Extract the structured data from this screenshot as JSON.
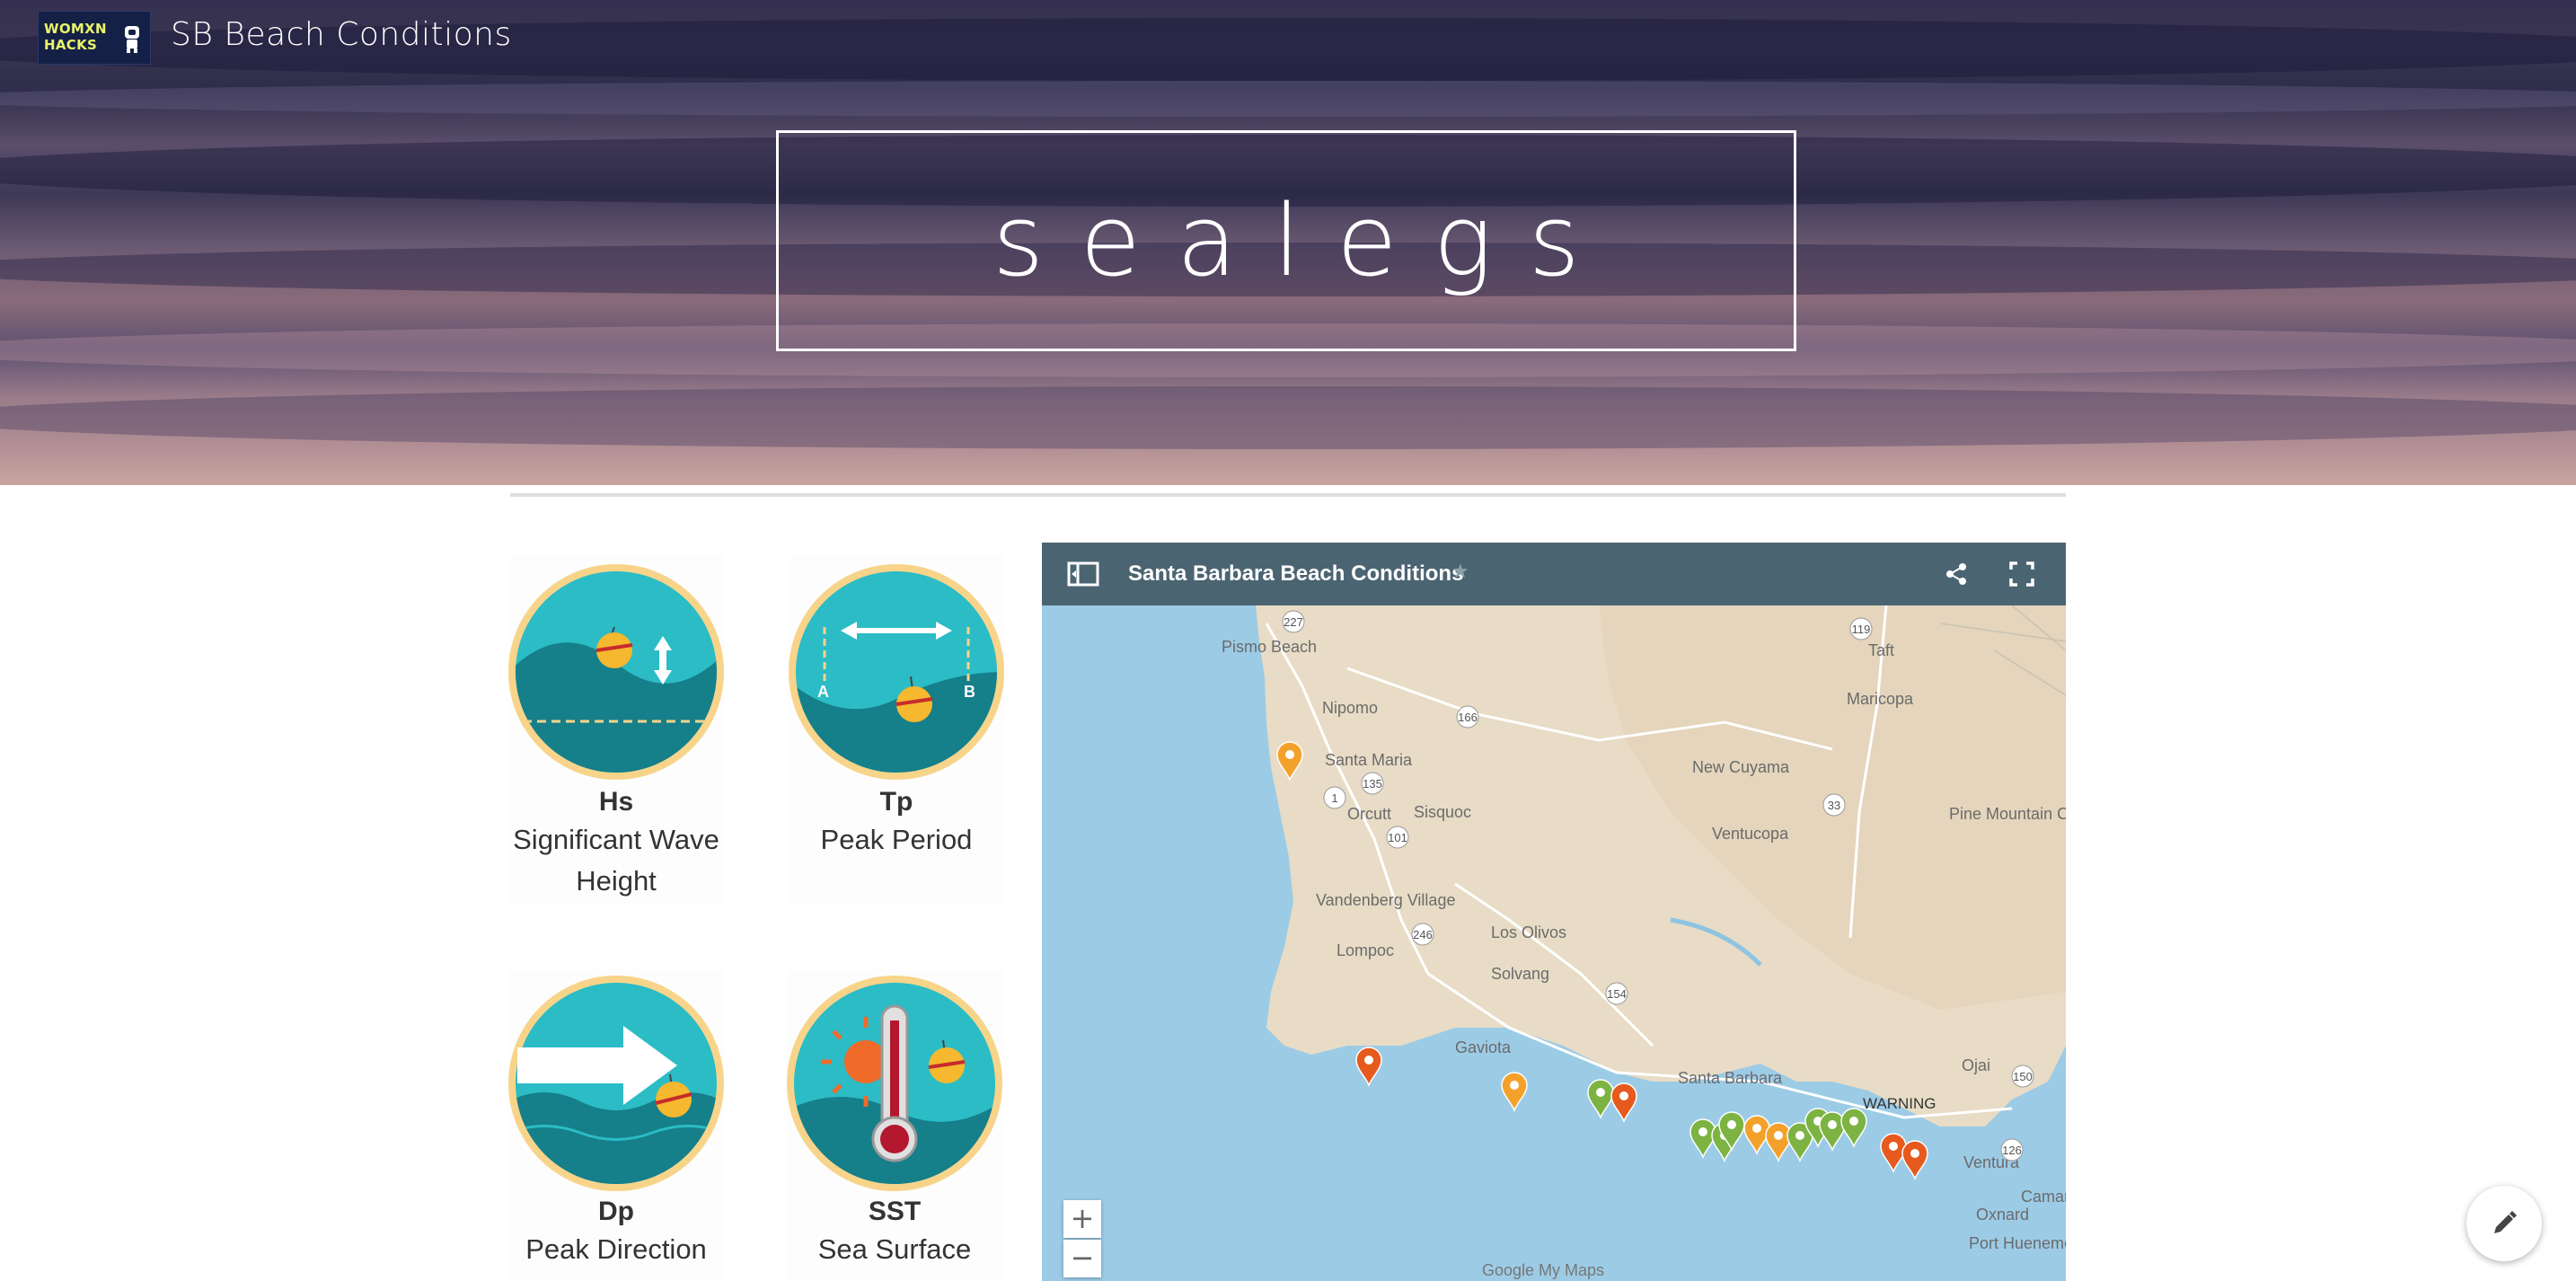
{
  "header": {
    "logo_line1": "WOMXN",
    "logo_line2": "HACKS",
    "site_title": "SB Beach Conditions",
    "hero_title": "sealegs"
  },
  "metrics": [
    {
      "abbr": "Hs",
      "name": "Significant Wave Height",
      "icon": "wave-height-icon"
    },
    {
      "abbr": "Tp",
      "name": "Peak Period",
      "icon": "peak-period-icon"
    },
    {
      "abbr": "Dp",
      "name": "Peak Direction",
      "icon": "peak-direction-icon"
    },
    {
      "abbr": "SST",
      "name": "Sea Surface",
      "icon": "thermometer-icon"
    }
  ],
  "map": {
    "title": "Santa Barbara Beach Conditions",
    "zoom_in": "+",
    "zoom_out": "−",
    "attribution": "Google My Maps",
    "places": [
      "Pismo Beach",
      "Nipomo",
      "Santa Maria",
      "Orcutt",
      "Sisquoc",
      "Vandenberg Village",
      "Lompoc",
      "Los Olivos",
      "Solvang",
      "Gaviota",
      "Santa Barbara",
      "New Cuyama",
      "Ventucopa",
      "Maricopa",
      "Taft",
      "Pine Mountain Club",
      "Ojai",
      "Ventura",
      "Oxnard",
      "Camarillo",
      "Port Hueneme"
    ],
    "route_shields": [
      "101",
      "227",
      "1",
      "166",
      "135",
      "246",
      "154",
      "33",
      "119",
      "150",
      "126"
    ],
    "marker_label": "WARNING",
    "marker_colors": {
      "good": "#7cb342",
      "caution": "#f4a12c",
      "warning": "#e65a1e"
    }
  }
}
